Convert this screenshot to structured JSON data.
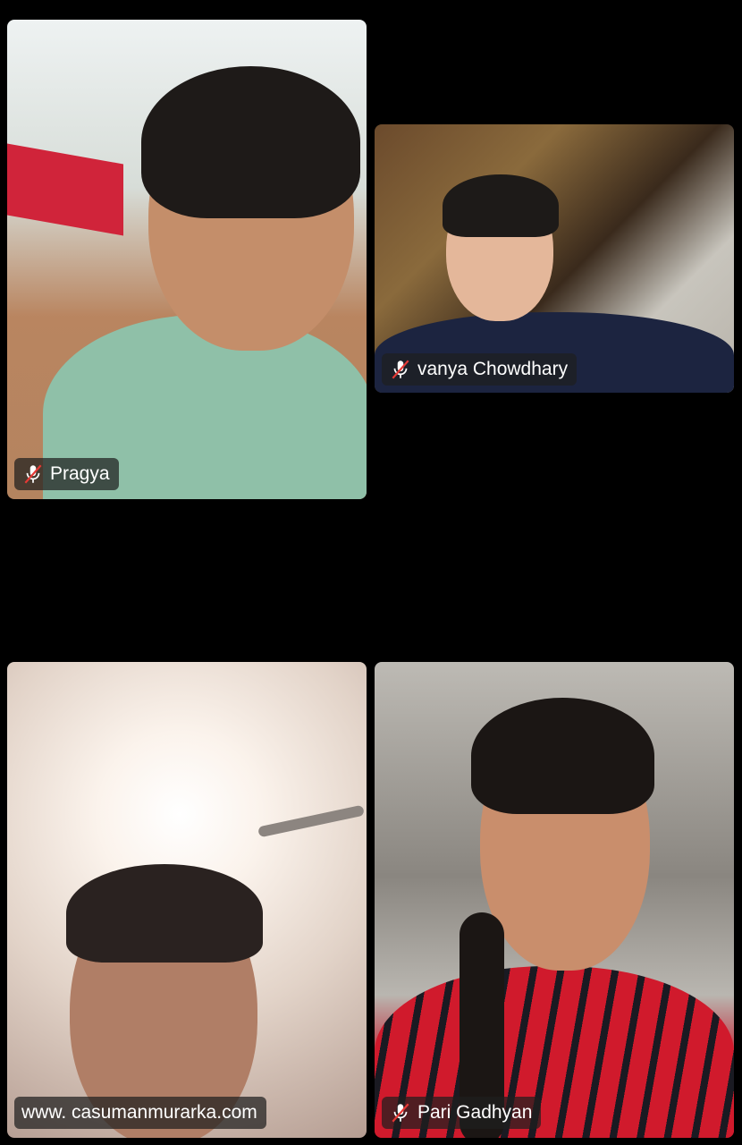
{
  "participants": [
    {
      "name": "Pragya",
      "muted": true,
      "icon": "mic-off-icon"
    },
    {
      "name": "vanya Chowdhary",
      "muted": true,
      "icon": "mic-off-icon"
    },
    {
      "name": "www. casumanmurarka.com",
      "muted": false,
      "icon": ""
    },
    {
      "name": "Pari Gadhyan",
      "muted": true,
      "icon": "mic-off-icon"
    }
  ],
  "colors": {
    "background": "#000000",
    "name_tag_bg": "rgba(30,30,30,0.72)",
    "mic_off_slash": "#e53935"
  }
}
